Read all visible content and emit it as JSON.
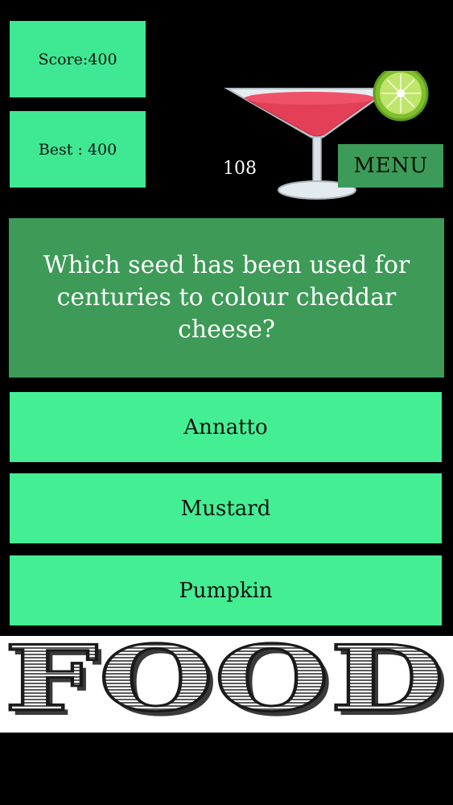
{
  "stats": {
    "score_label": "Score:400",
    "best_label": "Best : 400"
  },
  "timer": {
    "value": "108"
  },
  "menu": {
    "label": "MENU"
  },
  "question": {
    "text": "Which seed has been used for centuries to colour cheddar cheese?"
  },
  "answers": [
    {
      "label": "Annatto"
    },
    {
      "label": "Mustard"
    },
    {
      "label": "Pumpkin"
    }
  ],
  "banner": {
    "logo_text": "FOOD"
  },
  "colors": {
    "background": "#000000",
    "answer_green": "#44ef93",
    "question_green": "#3d9a57",
    "menu_green": "#3c9b58"
  },
  "icons": {
    "cocktail": "cocktail-glass-icon"
  }
}
